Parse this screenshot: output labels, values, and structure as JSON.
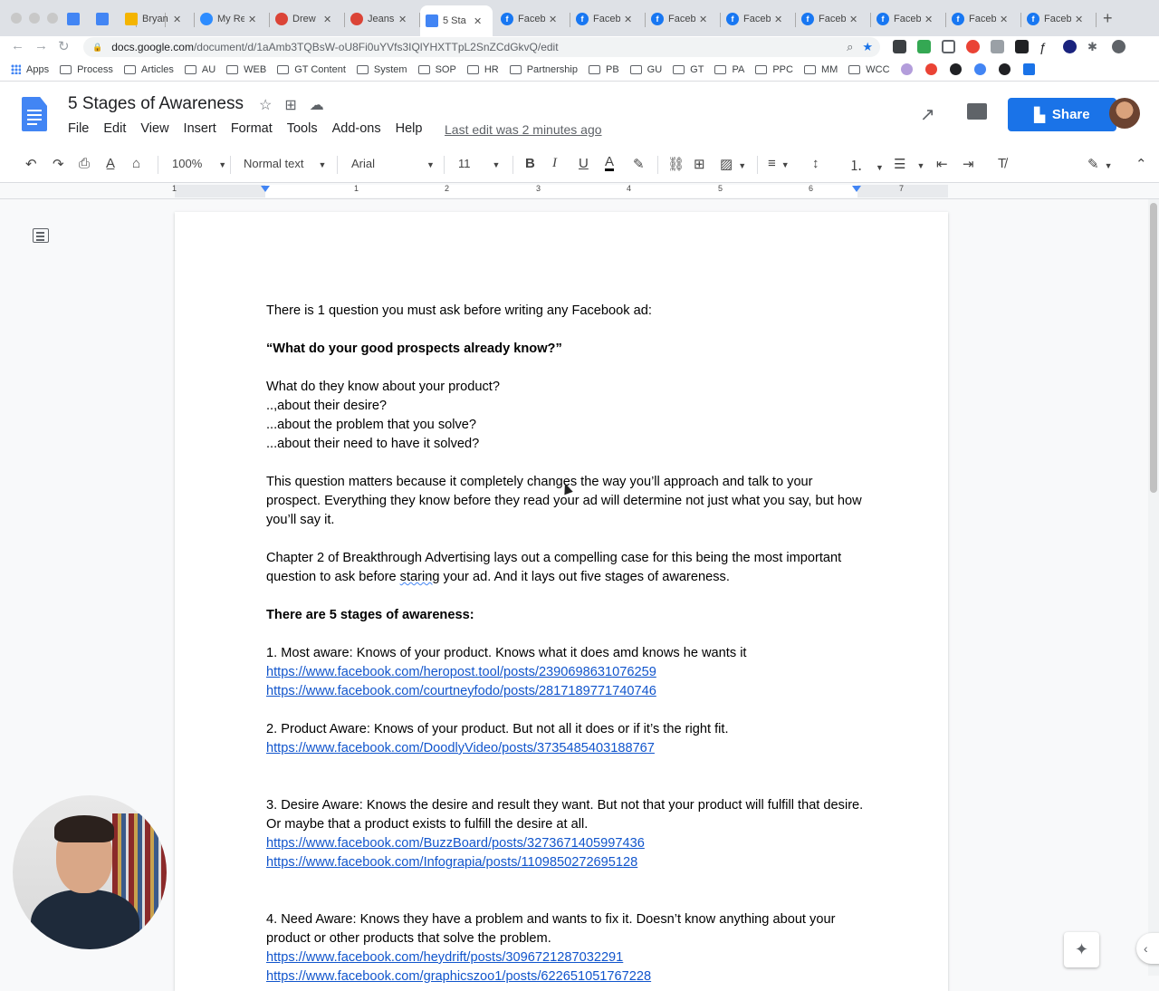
{
  "browser": {
    "tabs": [
      {
        "label": "",
        "icon": "google-docs-icon",
        "color": "#4285f4"
      },
      {
        "label": "",
        "icon": "google-docs-icon",
        "color": "#4285f4"
      },
      {
        "label": "Bryan",
        "icon": "google-slides-icon",
        "color": "#f4b400"
      },
      {
        "label": "My Re",
        "icon": "zoom-icon",
        "color": "#2d8cff"
      },
      {
        "label": "Drew",
        "icon": "chrome-icon",
        "color": "#db4437"
      },
      {
        "label": "Jeans",
        "icon": "chrome-icon",
        "color": "#db4437"
      },
      {
        "label": "5 Sta",
        "icon": "google-docs-icon",
        "color": "#4285f4",
        "active": true
      },
      {
        "label": "Faceb",
        "icon": "facebook-icon",
        "color": "#1877f2"
      },
      {
        "label": "Faceb",
        "icon": "facebook-icon",
        "color": "#1877f2"
      },
      {
        "label": "Faceb",
        "icon": "facebook-icon",
        "color": "#1877f2"
      },
      {
        "label": "Faceb",
        "icon": "facebook-icon",
        "color": "#1877f2"
      },
      {
        "label": "Faceb",
        "icon": "facebook-icon",
        "color": "#1877f2"
      },
      {
        "label": "Faceb",
        "icon": "facebook-icon",
        "color": "#1877f2"
      },
      {
        "label": "Faceb",
        "icon": "facebook-icon",
        "color": "#1877f2"
      },
      {
        "label": "Faceb",
        "icon": "facebook-icon",
        "color": "#1877f2"
      }
    ],
    "url_host": "docs.google.com",
    "url_path": "/document/d/1aAmb3TQBsW-oU8Fi0uYVfs3IQlYHXTTpL2SnZCdGkvQ/edit",
    "bookmarks": [
      "Apps",
      "Process",
      "Articles",
      "AU",
      "WEB",
      "GT Content",
      "System",
      "SOP",
      "HR",
      "Partnership",
      "PB",
      "GU",
      "GT",
      "PA",
      "PPC",
      "MM",
      "WCC"
    ]
  },
  "docs": {
    "title": "5 Stages of Awareness",
    "menu": [
      "File",
      "Edit",
      "View",
      "Insert",
      "Format",
      "Tools",
      "Add-ons",
      "Help"
    ],
    "last_edit": "Last edit was 2 minutes ago",
    "share_label": "Share",
    "accent": "#1a73e8"
  },
  "toolbar": {
    "zoom": "100%",
    "style": "Normal text",
    "font": "Arial",
    "size": "11"
  },
  "ruler": {
    "numbers": [
      "1",
      "1",
      "2",
      "3",
      "4",
      "5",
      "6",
      "7"
    ]
  },
  "body": {
    "p1": "There is 1 question you must ask before writing any Facebook ad:",
    "p2": "“What do your good prospects already know?”",
    "p3": "What do they know about your product?",
    "p4": "..,about their desire?",
    "p5": "...about the problem that you solve?",
    "p6": "...about their need to have it solved?",
    "p7": "This question matters because it completely changes the way you’ll approach and talk to your prospect. Everything they know before they read your ad will determine not just what you say, but how you’ll say it.",
    "p8a": "Chapter 2 of Breakthrough Advertising lays out a compelling case for this being the most important question to ask before ",
    "p8b": "staring",
    "p8c": " your ad. And it lays out five stages of awareness.",
    "p9": "There are 5 stages of awareness:",
    "s1": "1. Most aware: Knows of your product. Knows what it does amd knows he wants it",
    "s1l1": "https://www.facebook.com/heropost.tool/posts/2390698631076259",
    "s1l2": "https://www.facebook.com/courtneyfodo/posts/2817189771740746",
    "s2": "2. Product Aware: Knows of your product. But not all it does or if it’s the right fit.",
    "s2l1": "https://www.facebook.com/DoodlyVideo/posts/3735485403188767",
    "s3": "3. Desire Aware: Knows the desire and result they want. But not that your product will fulfill that desire. Or maybe that a product exists to fulfill the desire at all.",
    "s3l1": "https://www.facebook.com/BuzzBoard/posts/3273671405997436",
    "s3l2": "https://www.facebook.com/Infograpia/posts/1109850272695128",
    "s4": "4. Need Aware: Knows they have a problem and wants to fix it. Doesn’t know anything about your product or other products that solve the problem.",
    "s4l1": "https://www.facebook.com/heydrift/posts/3096721287032291",
    "s4l2": "https://www.facebook.com/graphicszoo1/posts/622651051767228"
  }
}
